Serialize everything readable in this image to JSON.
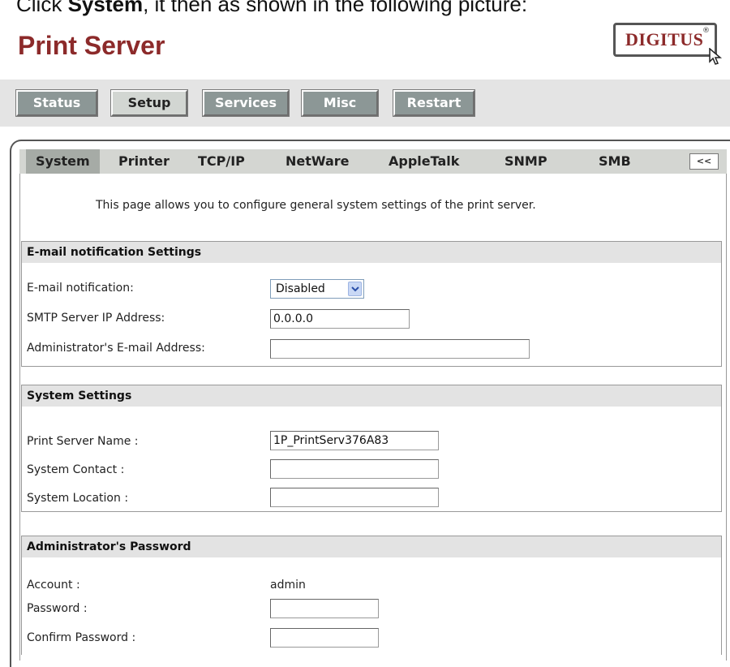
{
  "caption": {
    "pre": "Click ",
    "bold": "System",
    "post": ", it then as shown in the following picture:"
  },
  "header": {
    "title": "Print Server",
    "logo_text": "DIGITUS",
    "logo_reg": "®"
  },
  "nav": {
    "status": "Status",
    "setup": "Setup",
    "services": "Services",
    "misc": "Misc",
    "restart": "Restart"
  },
  "tabs": {
    "system": "System",
    "printer": "Printer",
    "tcpip": "TCP/IP",
    "netware": "NetWare",
    "appletalk": "AppleTalk",
    "snmp": "SNMP",
    "smb": "SMB",
    "more": "<<"
  },
  "intro": "This page allows you to configure general system settings of the print server.",
  "email": {
    "header": "E-mail notification Settings",
    "notify_label": "E-mail notification:",
    "notify_value": "Disabled",
    "smtp_label": "SMTP Server IP Address:",
    "smtp_value": "0.0.0.0",
    "admin_email_label": "Administrator's E-mail Address:",
    "admin_email_value": ""
  },
  "system": {
    "header": "System Settings",
    "name_label": "Print Server Name :",
    "name_value": "1P_PrintServ376A83",
    "contact_label": "System Contact :",
    "contact_value": "",
    "location_label": "System Location :",
    "location_value": ""
  },
  "password": {
    "header": "Administrator's Password",
    "account_label": "Account :",
    "account_value": "admin",
    "password_label": "Password :",
    "password_value": "",
    "confirm_label": "Confirm Password :",
    "confirm_value": ""
  },
  "colors": {
    "title": "#8c2a2a",
    "nav_dark": "#8c9796",
    "nav_light": "#d2d6d2",
    "tabbar": "#d4d6d2",
    "section_header": "#e3e3e3"
  }
}
